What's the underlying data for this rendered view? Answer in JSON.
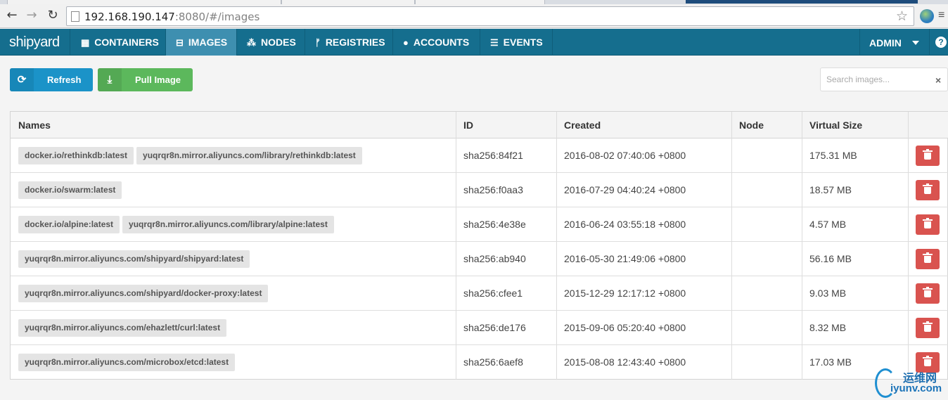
{
  "browser": {
    "url_host": "192.168.190.147",
    "url_path": ":8080/#/images"
  },
  "navbar": {
    "brand": "shipyard",
    "items": [
      {
        "label": "CONTAINERS",
        "icon": "grid-icon"
      },
      {
        "label": "IMAGES",
        "icon": "hdd-icon",
        "active": true
      },
      {
        "label": "NODES",
        "icon": "sitemap-icon"
      },
      {
        "label": "REGISTRIES",
        "icon": "code-fork-icon"
      },
      {
        "label": "ACCOUNTS",
        "icon": "user-icon"
      },
      {
        "label": "EVENTS",
        "icon": "list-icon"
      }
    ],
    "user": "ADMIN"
  },
  "toolbar": {
    "refresh_label": "Refresh",
    "pull_label": "Pull Image",
    "search_placeholder": "Search images..."
  },
  "table": {
    "headers": {
      "names": "Names",
      "id": "ID",
      "created": "Created",
      "node": "Node",
      "size": "Virtual Size"
    },
    "rows": [
      {
        "names": [
          "docker.io/rethinkdb:latest",
          "yuqrqr8n.mirror.aliyuncs.com/library/rethinkdb:latest"
        ],
        "id": "sha256:84f21",
        "created": "2016-08-02 07:40:06 +0800",
        "node": "",
        "size": "175.31 MB"
      },
      {
        "names": [
          "docker.io/swarm:latest"
        ],
        "id": "sha256:f0aa3",
        "created": "2016-07-29 04:40:24 +0800",
        "node": "",
        "size": "18.57 MB"
      },
      {
        "names": [
          "docker.io/alpine:latest",
          "yuqrqr8n.mirror.aliyuncs.com/library/alpine:latest"
        ],
        "id": "sha256:4e38e",
        "created": "2016-06-24 03:55:18 +0800",
        "node": "",
        "size": "4.57 MB"
      },
      {
        "names": [
          "yuqrqr8n.mirror.aliyuncs.com/shipyard/shipyard:latest"
        ],
        "id": "sha256:ab940",
        "created": "2016-05-30 21:49:06 +0800",
        "node": "",
        "size": "56.16 MB"
      },
      {
        "names": [
          "yuqrqr8n.mirror.aliyuncs.com/shipyard/docker-proxy:latest"
        ],
        "id": "sha256:cfee1",
        "created": "2015-12-29 12:17:12 +0800",
        "node": "",
        "size": "9.03 MB"
      },
      {
        "names": [
          "yuqrqr8n.mirror.aliyuncs.com/ehazlett/curl:latest"
        ],
        "id": "sha256:de176",
        "created": "2015-09-06 05:20:40 +0800",
        "node": "",
        "size": "8.32 MB"
      },
      {
        "names": [
          "yuqrqr8n.mirror.aliyuncs.com/microbox/etcd:latest"
        ],
        "id": "sha256:6aef8",
        "created": "2015-08-08 12:43:40 +0800",
        "node": "",
        "size": "17.03 MB"
      }
    ]
  },
  "watermark": {
    "cn": "运维网",
    "en": "iyunv.com"
  },
  "colors": {
    "navbar": "#156e8e",
    "active_nav": "#3e8fb0",
    "refresh": "#1b93c8",
    "pull": "#5cb85c",
    "delete": "#d9534f"
  }
}
